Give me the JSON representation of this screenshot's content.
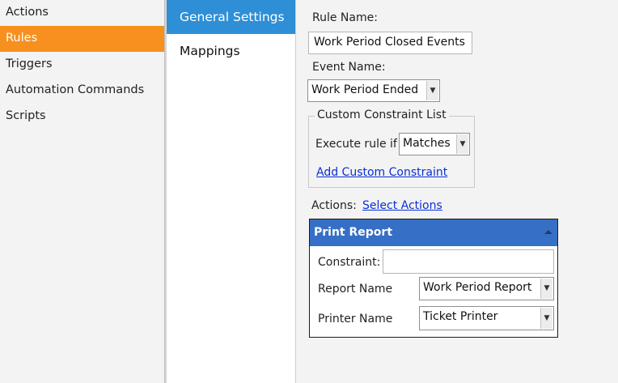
{
  "sidebar": {
    "items": [
      {
        "label": "Actions"
      },
      {
        "label": "Rules"
      },
      {
        "label": "Triggers"
      },
      {
        "label": "Automation Commands"
      },
      {
        "label": "Scripts"
      }
    ],
    "active": "Rules",
    "active_color": "#f7901e"
  },
  "tabs": {
    "items": [
      {
        "label": "General Settings"
      },
      {
        "label": "Mappings"
      }
    ],
    "active": "General Settings",
    "active_color": "#2e8fd7"
  },
  "form": {
    "rule_name_label": "Rule Name:",
    "rule_name_value": "Work Period Closed Events",
    "event_name_label": "Event Name:",
    "event_name_value": "Work Period Ended",
    "constraint_group": {
      "title": "Custom Constraint List",
      "execute_label": "Execute rule if",
      "execute_value": "Matches",
      "add_link": "Add Custom Constraint"
    },
    "actions_label": "Actions:",
    "select_actions_link": "Select Actions"
  },
  "action_panel": {
    "title": "Print Report",
    "header_color": "#356fc6",
    "constraint_label": "Constraint:",
    "constraint_value": "",
    "report_name_label": "Report Name",
    "report_name_value": "Work Period Report",
    "printer_name_label": "Printer Name",
    "printer_name_value": "Ticket Printer"
  }
}
